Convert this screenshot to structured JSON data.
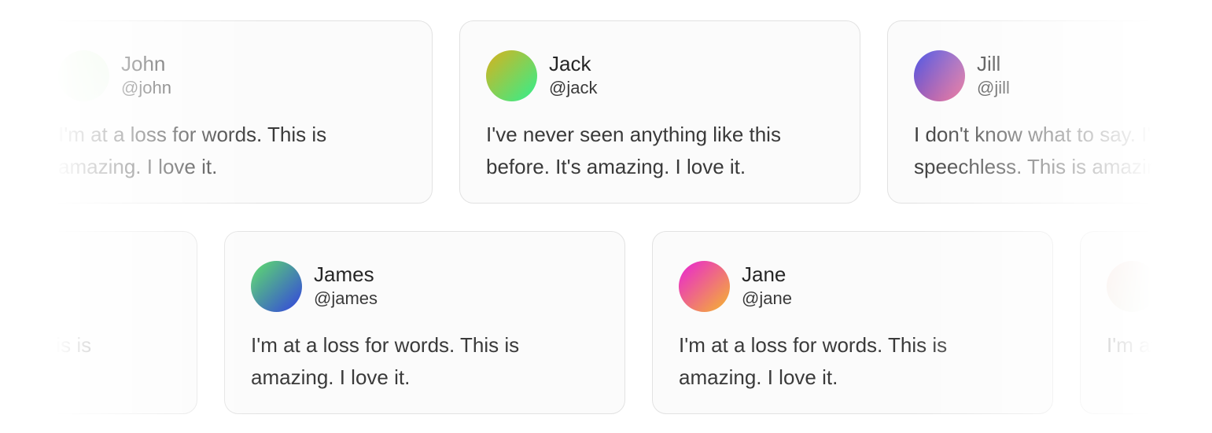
{
  "rows": [
    {
      "cards": [
        {
          "name": "John",
          "handle": "@john",
          "body": "I'm at a loss for words. This is amazing. I love it.",
          "avatar_from": "#d7f5c9",
          "avatar_to": "#eef8f0"
        },
        {
          "name": "Jack",
          "handle": "@jack",
          "body": "I've never seen anything like this before. It's amazing. I love it.",
          "avatar_from": "#d9b11c",
          "avatar_to": "#2ff08f"
        },
        {
          "name": "Jill",
          "handle": "@jill",
          "body": "I don't know what to say. I'm speechless. This is amazing.",
          "avatar_from": "#4b58e8",
          "avatar_to": "#e85d8a"
        }
      ]
    },
    {
      "cards": [
        {
          "name": "",
          "handle": "",
          "body": "I'm at a loss for words. This is amazing. I love it.",
          "avatar_from": "#eeeeee",
          "avatar_to": "#f6f6f6"
        },
        {
          "name": "James",
          "handle": "@james",
          "body": "I'm at a loss for words. This is amazing. I love it.",
          "avatar_from": "#5fe06a",
          "avatar_to": "#3341e0"
        },
        {
          "name": "Jane",
          "handle": "@jane",
          "body": "I'm at a loss for words. This is amazing. I love it.",
          "avatar_from": "#e822d6",
          "avatar_to": "#f5b72c"
        },
        {
          "name": "",
          "handle": "",
          "body": "I'm at a loss for words. This is amazing. I love it.",
          "avatar_from": "#f2c7bf",
          "avatar_to": "#d8eed9"
        }
      ]
    }
  ]
}
